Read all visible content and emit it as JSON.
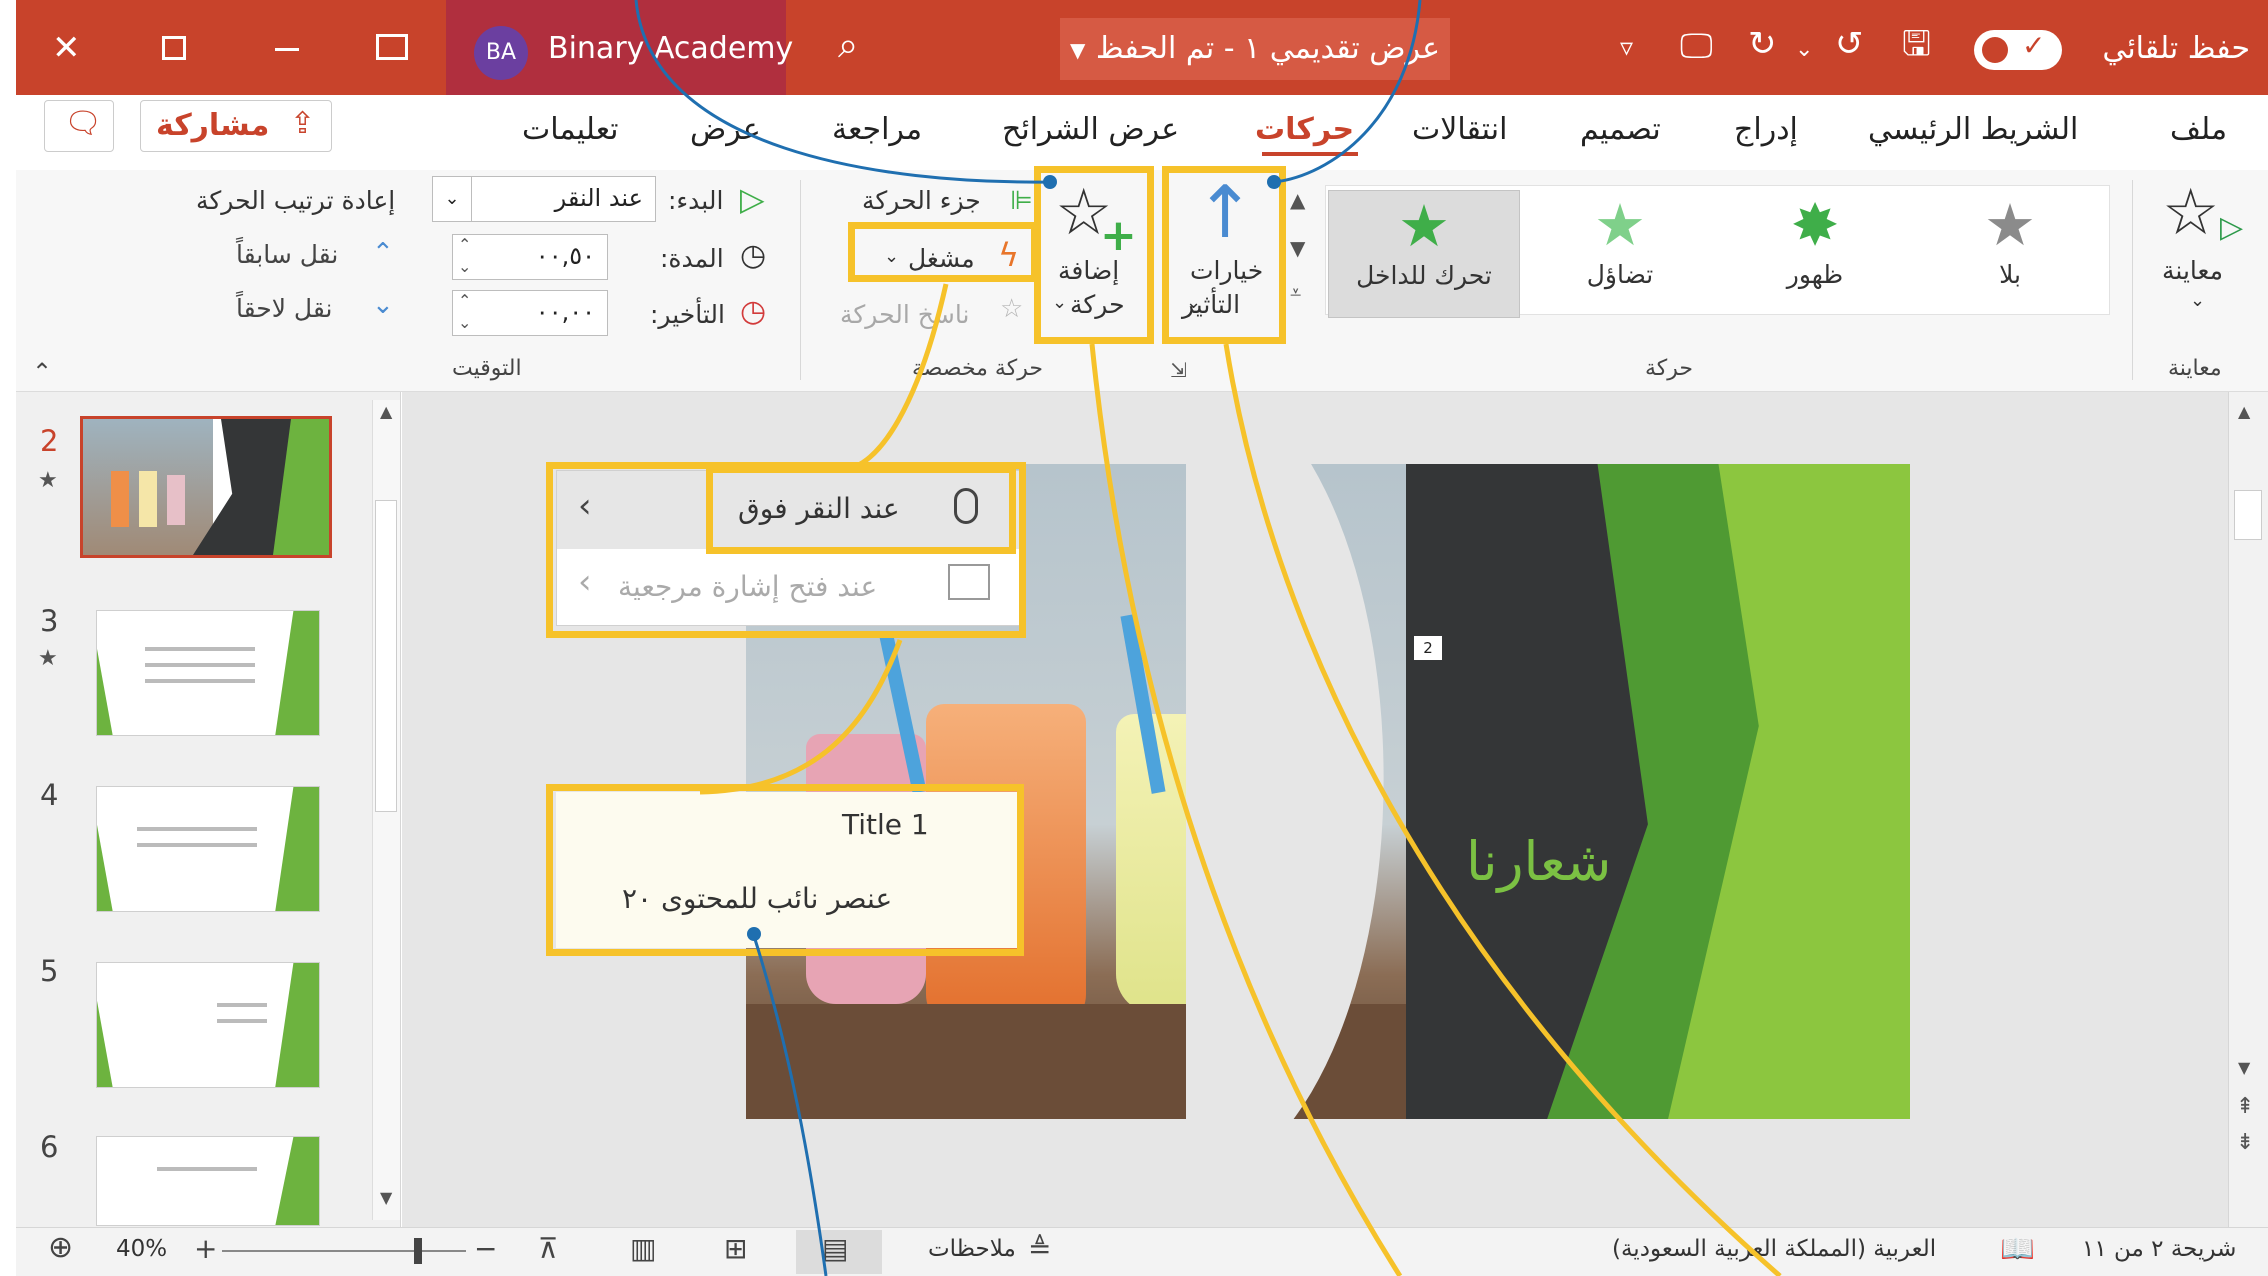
{
  "title_bar": {
    "autosave_label": "حفظ تلقائي",
    "doc_title": "عرض تقديمي ١ - تم الحفظ",
    "account_name": "Binary Academy",
    "avatar_initials": "BA"
  },
  "tabs": [
    "ملف",
    "الشريط الرئيسي",
    "إدراج",
    "تصميم",
    "انتقالات",
    "حركات",
    "عرض الشرائح",
    "مراجعة",
    "عرض",
    "تعليمات"
  ],
  "share_label": "مشاركة",
  "ribbon": {
    "preview_label": "معاينة",
    "preview_group": "معاينة",
    "animations": [
      "بلا",
      "ظهور",
      "تضاؤل",
      "تحرك للداخل"
    ],
    "animation_group": "حركة",
    "effect_options_line1": "خيارات",
    "effect_options_line2": "التأثير",
    "add_animation_line1": "إضافة",
    "add_animation_line2": "حركة",
    "animation_pane": "جزء الحركة",
    "trigger": "مشغل",
    "animation_painter": "ناسخ الحركة",
    "advanced_group": "حركة مخصصة",
    "start_label": "البدء:",
    "start_value": "عند النقر",
    "duration_label": "المدة:",
    "duration_value": "٠٠,٥٠",
    "delay_label": "التأخير:",
    "delay_value": "٠٠,٠٠",
    "reorder_label": "إعادة ترتيب الحركة",
    "move_earlier": "نقل سابقاً",
    "move_later": "نقل لاحقاً",
    "timing_group": "التوقيت"
  },
  "trigger_menu": {
    "on_click_of": "عند النقر فوق",
    "on_bookmark": "عند فتح إشارة مرجعية"
  },
  "trigger_submenu": {
    "item1": "Title 1",
    "item2": "عنصر نائب للمحتوى ٢٠"
  },
  "slide": {
    "title": "شعارنا",
    "marker": "2"
  },
  "thumbnails": [
    {
      "num": "2",
      "star": "★"
    },
    {
      "num": "3",
      "star": "★"
    },
    {
      "num": "4",
      "star": ""
    },
    {
      "num": "5",
      "star": ""
    },
    {
      "num": "6",
      "star": ""
    }
  ],
  "status": {
    "slide_info": "شريحة ٢ من ١١",
    "language": "العربية (المملكة العربية السعودية)",
    "notes": "ملاحظات",
    "zoom": "40%"
  },
  "colors": {
    "title_bar": "#c8432b",
    "callout": "#f6c22a",
    "leader_blue": "#1f6fb0",
    "slide_green": "#6db33f",
    "slide_dark": "#333536"
  }
}
